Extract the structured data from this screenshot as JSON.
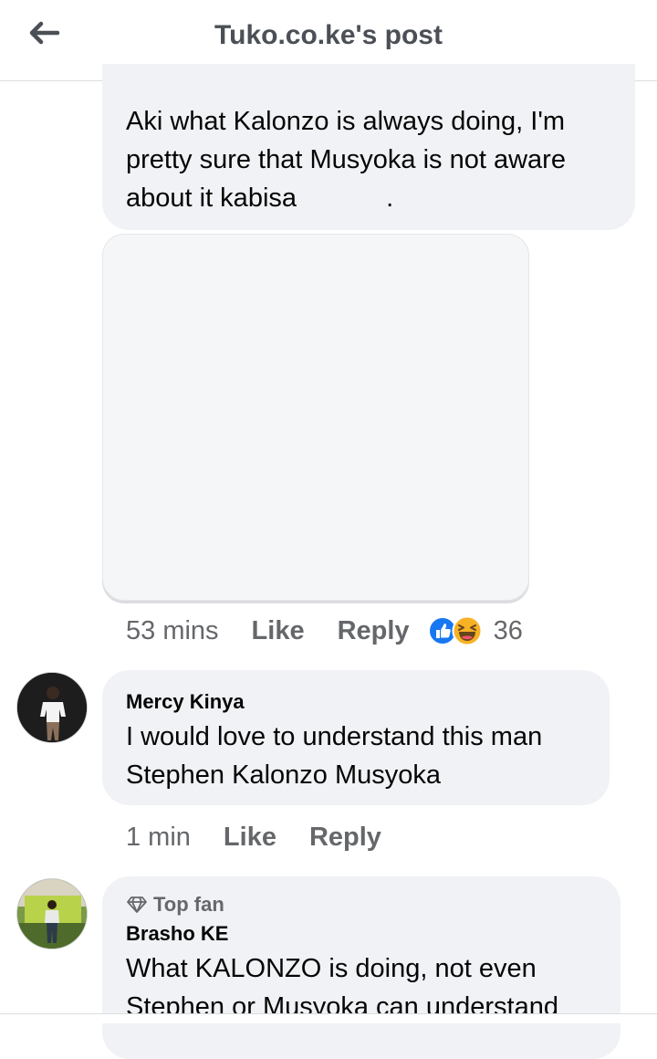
{
  "header": {
    "title": "Tuko.co.ke's post",
    "back_icon": "arrow-left-icon"
  },
  "comment1": {
    "text": "Aki what Kalonzo is always doing, I'm pretty sure that Musyoka is not aware about it kabisa",
    "trailing": ".",
    "time": "53 mins",
    "like_label": "Like",
    "reply_label": "Reply",
    "reaction_icons": [
      "like-reaction-icon",
      "haha-reaction-icon"
    ],
    "reaction_count": "36"
  },
  "comment2": {
    "author": "Mercy Kinya",
    "text": "I would love to understand this man Stephen Kalonzo Musyoka",
    "time": "1 min",
    "like_label": "Like",
    "reply_label": "Reply"
  },
  "comment3": {
    "badge": "Top fan",
    "badge_icon": "diamond-icon",
    "author": "Brasho KE",
    "text": "What KALONZO is doing, not even Stephen or Musyoka can understand"
  },
  "colors": {
    "bubble": "#f0f2f5",
    "meta_text": "#65676b",
    "like_blue": "#1877f2",
    "haha_yellow": "#f7b125"
  }
}
